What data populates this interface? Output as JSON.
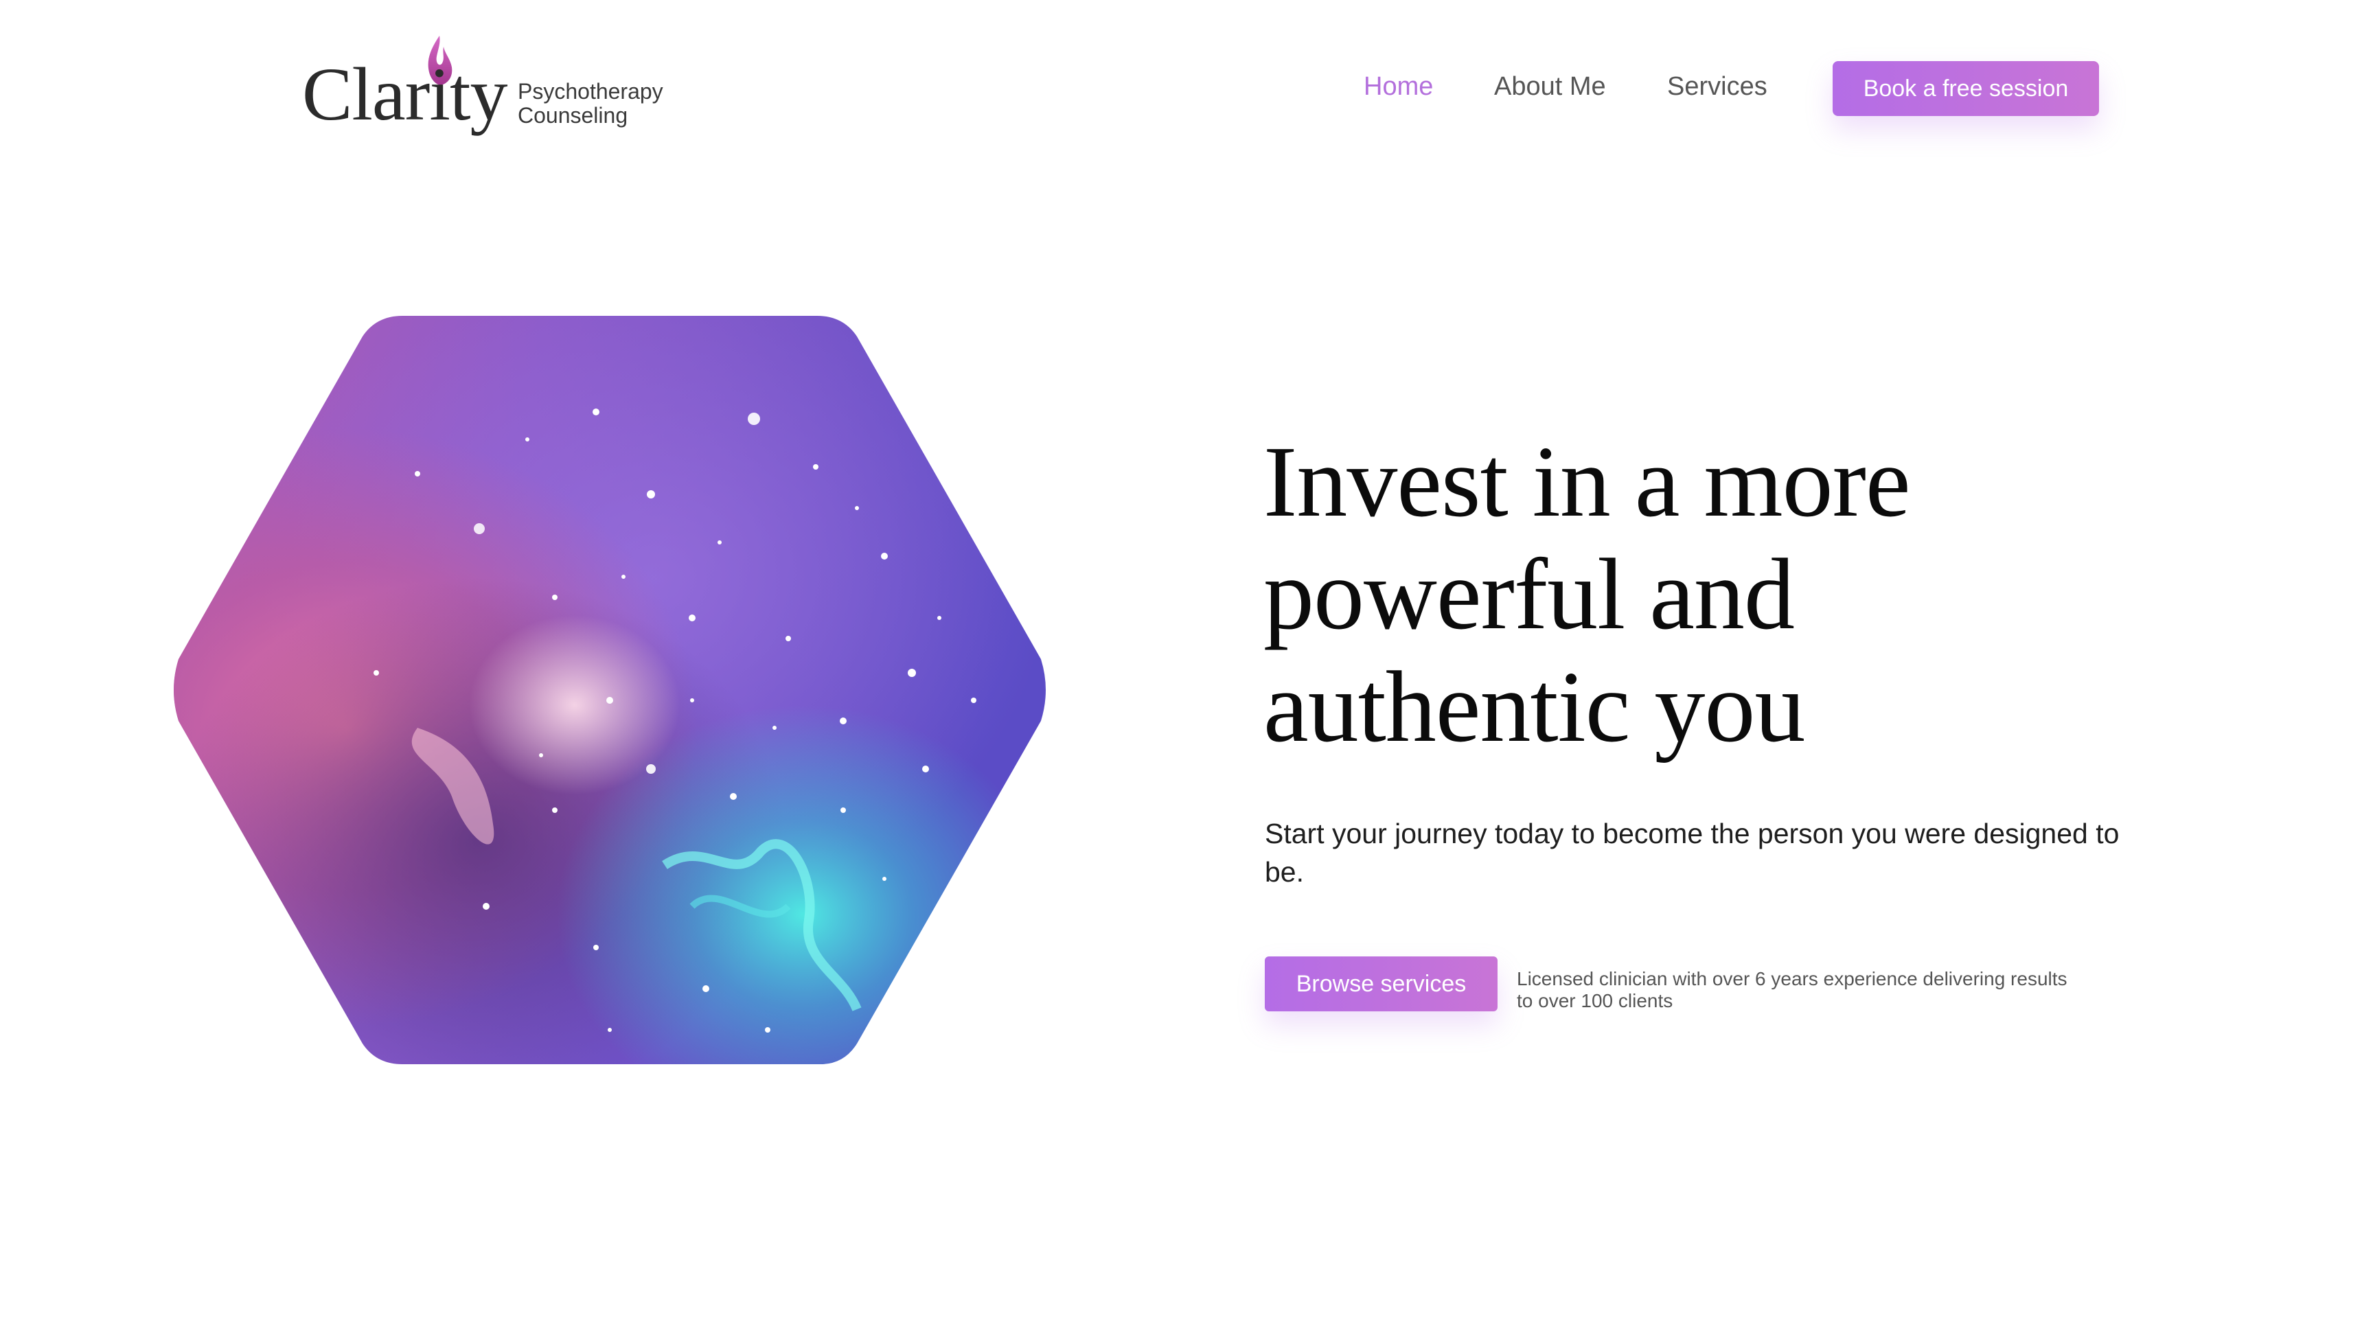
{
  "brand": {
    "name": "Clarity",
    "tagline_line1": "Psychotherapy",
    "tagline_line2": "Counseling",
    "icon": "flame-icon",
    "accent_color": "#b36fdc"
  },
  "nav": {
    "items": [
      {
        "label": "Home",
        "active": true
      },
      {
        "label": "About Me",
        "active": false
      },
      {
        "label": "Services",
        "active": false
      }
    ],
    "cta_label": "Book a free session"
  },
  "hero": {
    "image": "galaxy-nebula-hexagon",
    "headline_line1": "Invest in a more",
    "headline_line2": "powerful and",
    "headline_line3": "authentic you",
    "subhead": "Start your journey today to become the person you were designed to be.",
    "primary_button": "Browse services",
    "credential_line1": "Licensed clinician with over 6 years experience delivering results",
    "credential_line2": "to over 100 clients"
  },
  "colors": {
    "button_gradient_start": "#b46de6",
    "button_gradient_end": "#c874d6",
    "text_dark": "#0b0b0b",
    "nav_text": "#555555"
  }
}
